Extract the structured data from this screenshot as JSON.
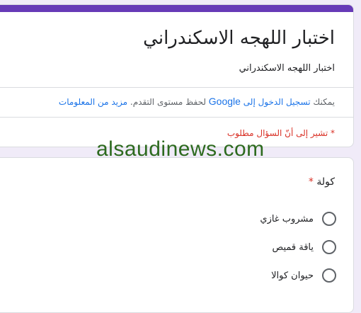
{
  "form": {
    "title": "اختبار اللهجه الاسكندراني",
    "description": "اختبار اللهجه الاسكندراني",
    "signin_prefix": "يمكنك",
    "signin_link": "تسجيل الدخول إلى",
    "signin_google": "Google",
    "signin_suffix": "لحفظ مستوى التقدم.",
    "learn_more": "مزيد من المعلومات",
    "required_note": "* تشير إلى أنّ السؤال مطلوب"
  },
  "watermark": "alsaudinews.com",
  "question": {
    "title": "كولة",
    "required_mark": "*",
    "options": [
      {
        "label": "مشروب غازي"
      },
      {
        "label": "ياقة قميص"
      },
      {
        "label": "حيوان كوالا"
      }
    ]
  },
  "colors": {
    "accent": "#673ab7",
    "link": "#1a73e8",
    "required": "#d93025",
    "background": "#f0ebf8"
  }
}
